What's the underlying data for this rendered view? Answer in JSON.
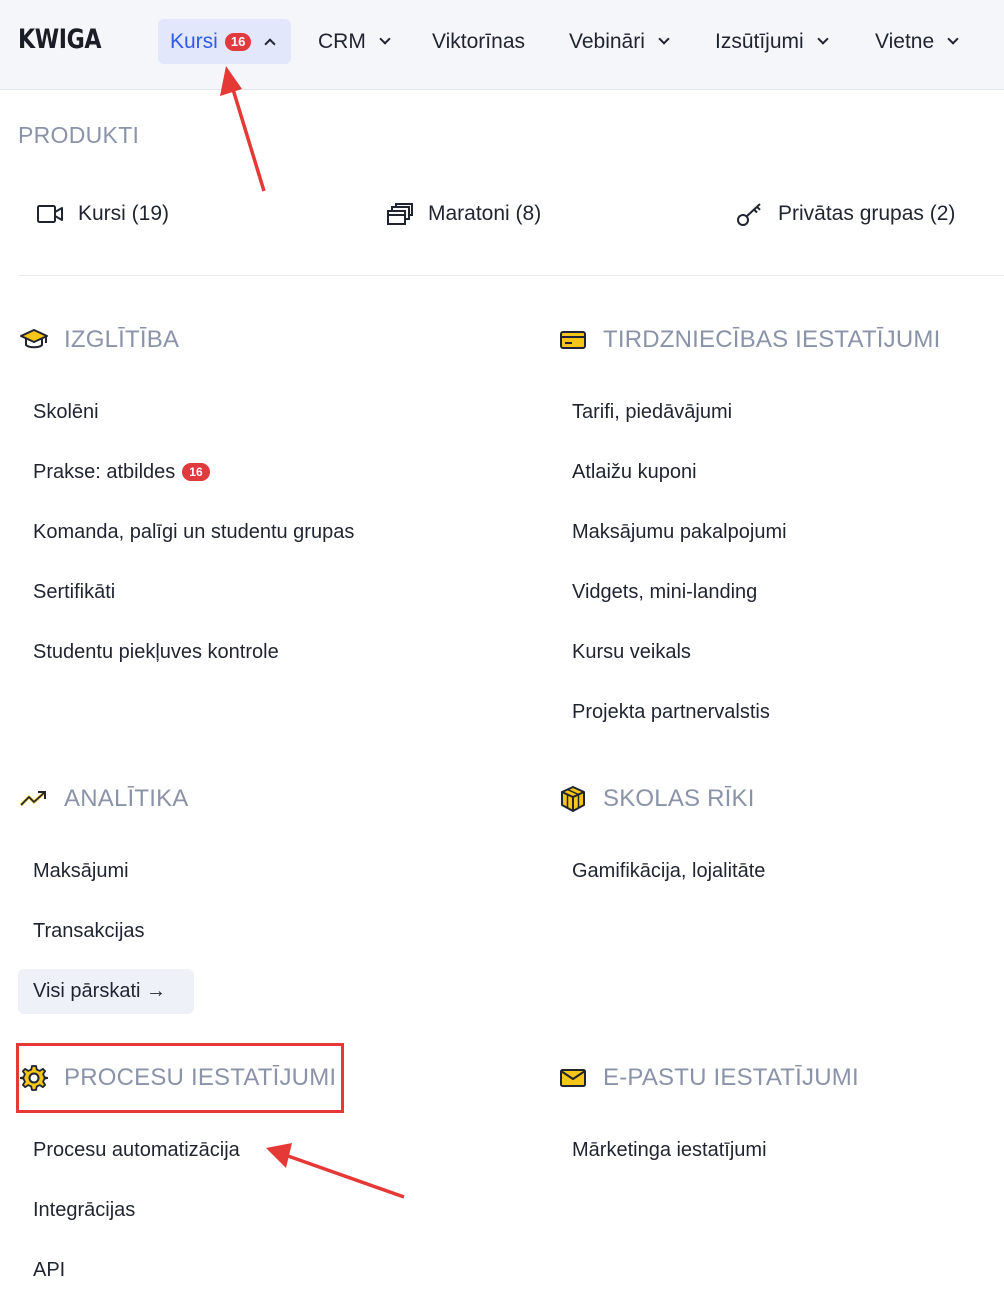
{
  "brand": {
    "logo": "KWIGA"
  },
  "nav": {
    "kursi": {
      "label": "Kursi",
      "badge": "16"
    },
    "crm": "CRM",
    "viktorinas": "Viktorīnas",
    "vebinari": "Vebināri",
    "izsutijumi": "Izsūtījumi",
    "vietne": "Vietne"
  },
  "produkti": {
    "heading": "PRODUKTI",
    "items": [
      "Kursi (19)",
      "Maratoni (8)",
      "Privātas grupas (2)"
    ]
  },
  "izglitiba": {
    "heading": "IZGLĪTĪBA",
    "items": [
      "Skolēni",
      "Prakse: atbildes",
      "Komanda, palīgi un studentu grupas",
      "Sertifikāti",
      "Studentu piekļuves kontrole"
    ],
    "badge": "16"
  },
  "tirdzniecibas": {
    "heading": "TIRDZNIECĪBAS IESTATĪJUMI",
    "items": [
      "Tarifi, piedāvājumi",
      "Atlaižu kuponi",
      "Maksājumu pakalpojumi",
      "Vidgets, mini-landing",
      "Kursu veikals",
      "Projekta partnervalstis"
    ]
  },
  "analitika": {
    "heading": "ANALĪTIKA",
    "items": [
      "Maksājumi",
      "Transakcijas"
    ],
    "all_reports": "Visi pārskati →"
  },
  "skolas_riki": {
    "heading": "SKOLAS RĪKI",
    "items": [
      "Gamifikācija, lojalitāte"
    ]
  },
  "procesu": {
    "heading": "PROCESU IESTATĪJUMI",
    "items": [
      "Procesu automatizācija",
      "Integrācijas",
      "API"
    ]
  },
  "epastu": {
    "heading": "E-PASTU IESTATĪJUMI",
    "items": [
      "Mārketinga iestatījumi"
    ]
  },
  "colors": {
    "accent": "#2f5bea",
    "badge": "#e0393e",
    "icon_yellow": "#f5c518",
    "annotation_red": "#e53935",
    "section_gray": "#8a93a8"
  }
}
